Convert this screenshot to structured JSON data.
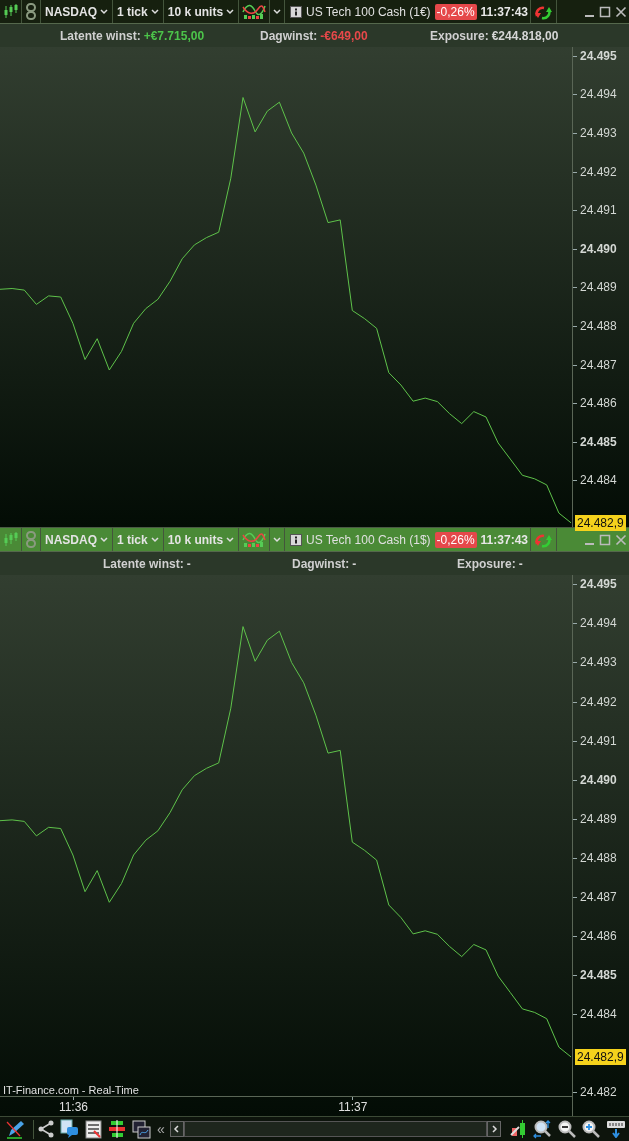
{
  "panels": [
    {
      "active": false,
      "toolbar": {
        "market": "NASDAQ",
        "interval": "1 tick",
        "size": "10 k units",
        "instrument": "US Tech 100 Cash (1€)",
        "change": "-0,26%",
        "time": "11:37:43"
      },
      "stats": [
        {
          "label": "Latente winst:",
          "value": "+€7.715,00",
          "color": "#4cc44a"
        },
        {
          "label": "Dagwinst:",
          "value": "-€649,00",
          "color": "#e8484a"
        },
        {
          "label": "Exposure:",
          "value": "€244.818,00",
          "color": "#d6d6d6"
        }
      ],
      "last_price": "24.482,9",
      "chart_data": {
        "type": "line",
        "ylim": [
          24482.79,
          24495.23
        ],
        "yticks": [
          {
            "value": 24484,
            "label": "24.484"
          },
          {
            "value": 24485,
            "label": "24.485"
          },
          {
            "value": 24486,
            "label": "24.486"
          },
          {
            "value": 24487,
            "label": "24.487"
          },
          {
            "value": 24488,
            "label": "24.488"
          },
          {
            "value": 24489,
            "label": "24.489"
          },
          {
            "value": 24490,
            "label": "24.490"
          },
          {
            "value": 24491,
            "label": "24.491"
          },
          {
            "value": 24492,
            "label": "24.492"
          },
          {
            "value": 24493,
            "label": "24.493"
          },
          {
            "value": 24494,
            "label": "24.494"
          },
          {
            "value": 24495,
            "label": "24.495"
          }
        ],
        "categories": [
          null,
          null,
          null,
          null,
          null,
          null,
          null,
          null,
          null,
          null,
          null,
          null,
          null,
          null,
          null,
          null,
          null,
          null,
          null,
          null,
          null,
          null,
          null,
          null,
          null,
          null,
          null,
          null,
          null,
          null,
          null,
          null,
          null,
          null,
          null,
          null,
          null,
          null,
          null,
          null,
          null,
          null,
          null,
          null,
          null,
          null,
          null,
          null
        ],
        "series": [
          {
            "color": "#5ec24a",
            "values": [
              24488.95,
              24488.97,
              24488.93,
              24488.56,
              24488.78,
              24488.75,
              24488.07,
              24487.13,
              24487.67,
              24486.86,
              24487.34,
              24488.07,
              24488.45,
              24488.69,
              24489.16,
              24489.74,
              24490.1,
              24490.29,
              24490.43,
              24491.83,
              24493.92,
              24493.03,
              24493.57,
              24493.8,
              24493.0,
              24492.48,
              24491.65,
              24490.68,
              24490.75,
              24488.4,
              24488.19,
              24487.94,
              24486.79,
              24486.47,
              24486.05,
              24486.13,
              24486.04,
              24485.73,
              24485.47,
              24485.78,
              24485.64,
              24484.97,
              24484.55,
              24484.13,
              24484.04,
              24483.88,
              24483.15,
              24482.9
            ]
          }
        ]
      }
    },
    {
      "active": true,
      "toolbar": {
        "market": "NASDAQ",
        "interval": "1 tick",
        "size": "10 k units",
        "instrument": "US Tech 100 Cash (1$)",
        "change": "-0,26%",
        "time": "11:37:43"
      },
      "stats": [
        {
          "label": "Latente winst:",
          "value": "-"
        },
        {
          "label": "Dagwinst:",
          "value": "-"
        },
        {
          "label": "Exposure:",
          "value": "-"
        }
      ],
      "last_price": "24.482,9",
      "source": "IT-Finance.com - Real-Time",
      "chart_data": {
        "type": "line",
        "ylim": [
          24481.9,
          24495.24
        ],
        "yticks": [
          {
            "value": 24482,
            "label": "24.482"
          },
          {
            "value": 24484,
            "label": "24.484"
          },
          {
            "value": 24485,
            "label": "24.485"
          },
          {
            "value": 24486,
            "label": "24.486"
          },
          {
            "value": 24487,
            "label": "24.487"
          },
          {
            "value": 24488,
            "label": "24.488"
          },
          {
            "value": 24489,
            "label": "24.489"
          },
          {
            "value": 24490,
            "label": "24.490"
          },
          {
            "value": 24491,
            "label": "24.491"
          },
          {
            "value": 24492,
            "label": "24.492"
          },
          {
            "value": 24493,
            "label": "24.493"
          },
          {
            "value": 24494,
            "label": "24.494"
          },
          {
            "value": 24495,
            "label": "24.495"
          }
        ],
        "categories": [
          null,
          null,
          null,
          null,
          null,
          null,
          "11:36",
          null,
          null,
          null,
          null,
          null,
          null,
          null,
          null,
          null,
          null,
          null,
          null,
          null,
          null,
          null,
          null,
          null,
          null,
          null,
          null,
          null,
          null,
          "11:37",
          null,
          null,
          null,
          null,
          null,
          null,
          null,
          null,
          null,
          null,
          null,
          null,
          null,
          null,
          null,
          null,
          null,
          null
        ],
        "series": [
          {
            "color": "#5ec24a",
            "values": [
              24488.95,
              24488.97,
              24488.93,
              24488.56,
              24488.78,
              24488.75,
              24488.07,
              24487.13,
              24487.67,
              24486.86,
              24487.34,
              24488.07,
              24488.45,
              24488.69,
              24489.16,
              24489.74,
              24490.1,
              24490.29,
              24490.43,
              24491.83,
              24493.92,
              24493.03,
              24493.57,
              24493.8,
              24493.0,
              24492.48,
              24491.65,
              24490.68,
              24490.75,
              24488.4,
              24488.19,
              24487.94,
              24486.79,
              24486.47,
              24486.05,
              24486.13,
              24486.04,
              24485.73,
              24485.47,
              24485.78,
              24485.64,
              24484.97,
              24484.55,
              24484.13,
              24484.04,
              24483.88,
              24483.15,
              24482.9
            ]
          }
        ]
      }
    }
  ],
  "bottom_toolbar": {
    "collapse": "«"
  }
}
